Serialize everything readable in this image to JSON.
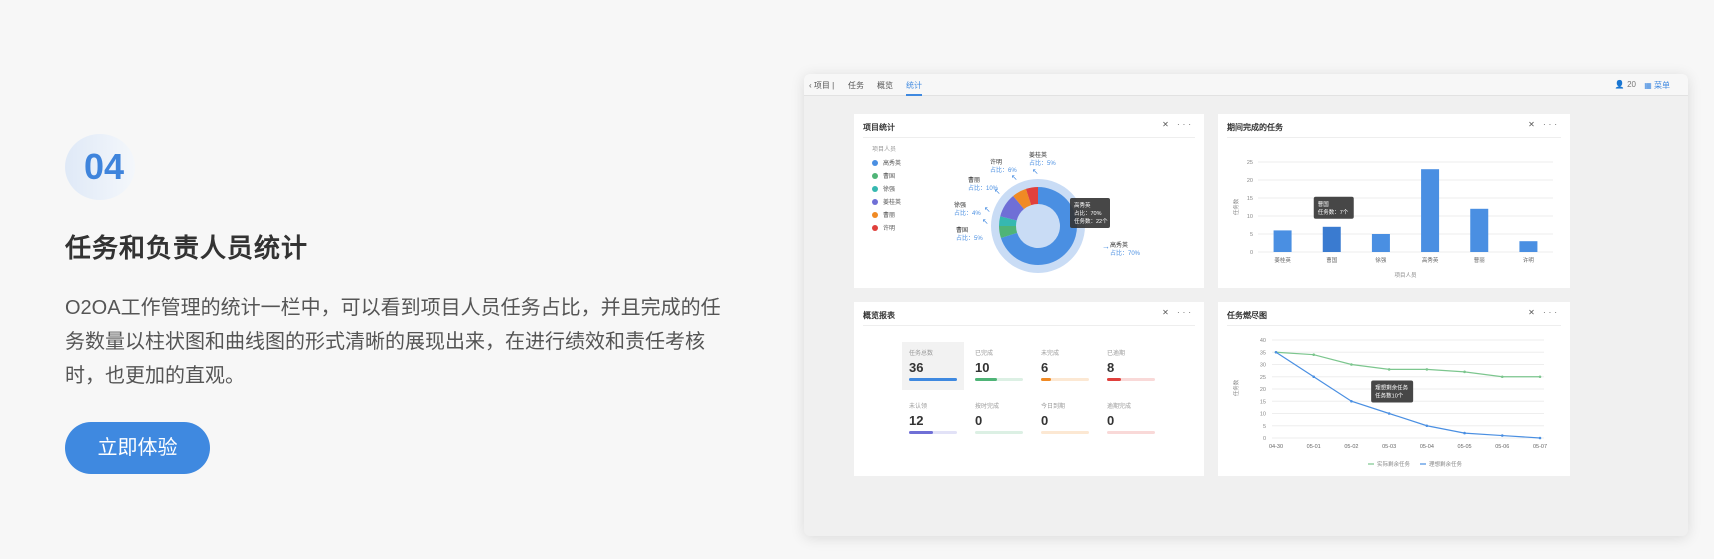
{
  "intro": {
    "number": "04",
    "title": "任务和负责人员统计",
    "description": "O2OA工作管理的统计一栏中，可以看到项目人员任务占比，并且完成的任务数量以柱状图和曲线图的形式清晰的展现出来，在进行绩效和责任考核时，也更加的直观。",
    "cta_label": "立即体验"
  },
  "topbar": {
    "back": "‹ 项目 |",
    "tabs": [
      "任务",
      "概览",
      "统计"
    ],
    "active_tab": "统计",
    "users": "20",
    "menu": "菜单"
  },
  "cards": {
    "project_stats": {
      "title": "项目统计",
      "tools": "✕ ···"
    },
    "period_tasks": {
      "title": "期间完成的任务",
      "tools": "✕ ···"
    },
    "overview": {
      "title": "概览报表",
      "tools": "✕ ···"
    },
    "burndown": {
      "title": "任务燃尽图",
      "tools": "✕ ···"
    }
  },
  "overview_stats": [
    {
      "label": "任务总数",
      "value": "36",
      "color": "#3f89e0",
      "fill": 1.0
    },
    {
      "label": "已完成",
      "value": "10",
      "color": "#4fb477",
      "fill": 0.45
    },
    {
      "label": "未完成",
      "value": "6",
      "color": "#f08a24",
      "fill": 0.2
    },
    {
      "label": "已逾期",
      "value": "8",
      "color": "#e0403c",
      "fill": 0.3
    },
    {
      "label": "未认领",
      "value": "12",
      "color": "#6f6fd6",
      "fill": 0.5
    },
    {
      "label": "按时完成",
      "value": "0",
      "color": "#4fb477",
      "fill": 0
    },
    {
      "label": "今日到期",
      "value": "0",
      "color": "#f08a24",
      "fill": 0
    },
    {
      "label": "逾期完成",
      "value": "0",
      "color": "#e0403c",
      "fill": 0
    }
  ],
  "chart_data": [
    {
      "type": "pie",
      "title": "项目统计",
      "legend_title": "项目人员",
      "categories": [
        "高秀英",
        "曹国",
        "徐强",
        "姜桂英",
        "曹丽",
        "许明"
      ],
      "values": [
        70,
        5,
        4,
        10,
        6,
        5
      ],
      "colors": [
        "#4a8fe2",
        "#4fb477",
        "#36b8b0",
        "#6f6fd6",
        "#f08a24",
        "#e0403c"
      ],
      "labels": [
        {
          "name": "高秀英",
          "pct": "占比：70%"
        },
        {
          "name": "曹国",
          "pct": "占比：5%"
        },
        {
          "name": "徐强",
          "pct": "占比：4%"
        },
        {
          "name": "曹丽",
          "pct": "占比：10%"
        },
        {
          "name": "许明",
          "pct": "占比：6%"
        },
        {
          "name": "姜桂英",
          "pct": "占比：5%"
        }
      ],
      "tooltip": [
        "高秀英",
        "占比：70%",
        "任务数：22个"
      ]
    },
    {
      "type": "bar",
      "title": "期间完成的任务",
      "categories": [
        "姜桂英",
        "曹国",
        "徐强",
        "高秀英",
        "曹丽",
        "许明"
      ],
      "values": [
        6,
        7,
        5,
        23,
        12,
        3
      ],
      "ylim": [
        0,
        25
      ],
      "yticks": [
        0,
        5,
        10,
        15,
        20,
        25
      ],
      "xlabel": "项目人员",
      "ylabel": "任务数",
      "color": "#4a8fe2",
      "tooltip": [
        "曹国",
        "任务数：7个"
      ]
    },
    {
      "type": "line",
      "title": "任务燃尽图",
      "x": [
        "04-30",
        "05-01",
        "05-02",
        "05-03",
        "05-04",
        "05-05",
        "05-06",
        "05-07"
      ],
      "series": [
        {
          "name": "实际剩余任务",
          "values": [
            35,
            34,
            30,
            28,
            28,
            27,
            25,
            25
          ],
          "color": "#7cc68e"
        },
        {
          "name": "理想剩余任务",
          "values": [
            35,
            25,
            15,
            10,
            5,
            2,
            1,
            0
          ],
          "color": "#4a8fe2"
        }
      ],
      "ylim": [
        0,
        40
      ],
      "yticks": [
        0,
        5,
        10,
        15,
        20,
        25,
        30,
        35,
        40
      ],
      "ylabel": "任务数",
      "tooltip": [
        "理想剩余任务",
        "任务数10个"
      ]
    }
  ]
}
